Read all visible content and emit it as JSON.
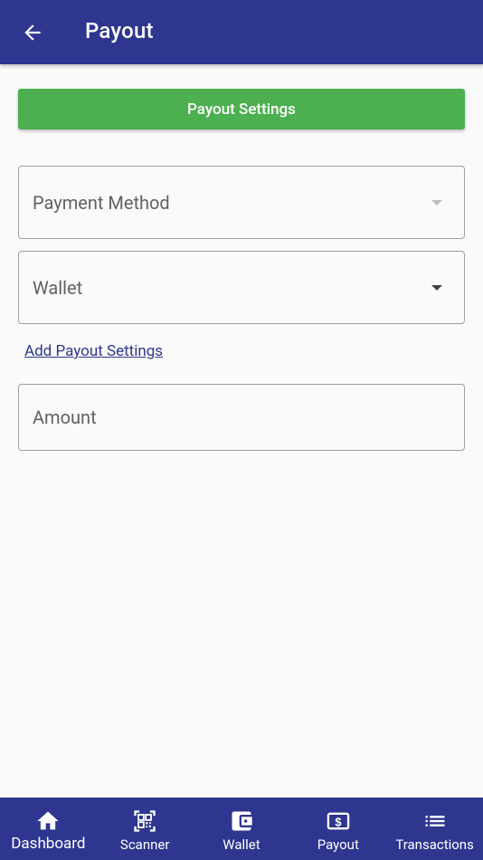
{
  "appbar": {
    "title": "Payout"
  },
  "settings_button": {
    "label": "Payout Settings"
  },
  "form": {
    "payment_method": {
      "placeholder": "Payment Method"
    },
    "wallet": {
      "value": "Wallet"
    },
    "add_link": "Add Payout Settings",
    "amount": {
      "placeholder": "Amount"
    }
  },
  "nav": {
    "items": [
      {
        "label": "Dashboard",
        "icon": "home-icon"
      },
      {
        "label": "Scanner",
        "icon": "qr-scanner-icon"
      },
      {
        "label": "Wallet",
        "icon": "wallet-icon"
      },
      {
        "label": "Payout",
        "icon": "payout-icon"
      },
      {
        "label": "Transactions",
        "icon": "list-icon"
      }
    ],
    "active": "Dashboard"
  },
  "colors": {
    "primary": "#2e3690",
    "accent_green": "#4caf50",
    "background": "#fafafa"
  }
}
